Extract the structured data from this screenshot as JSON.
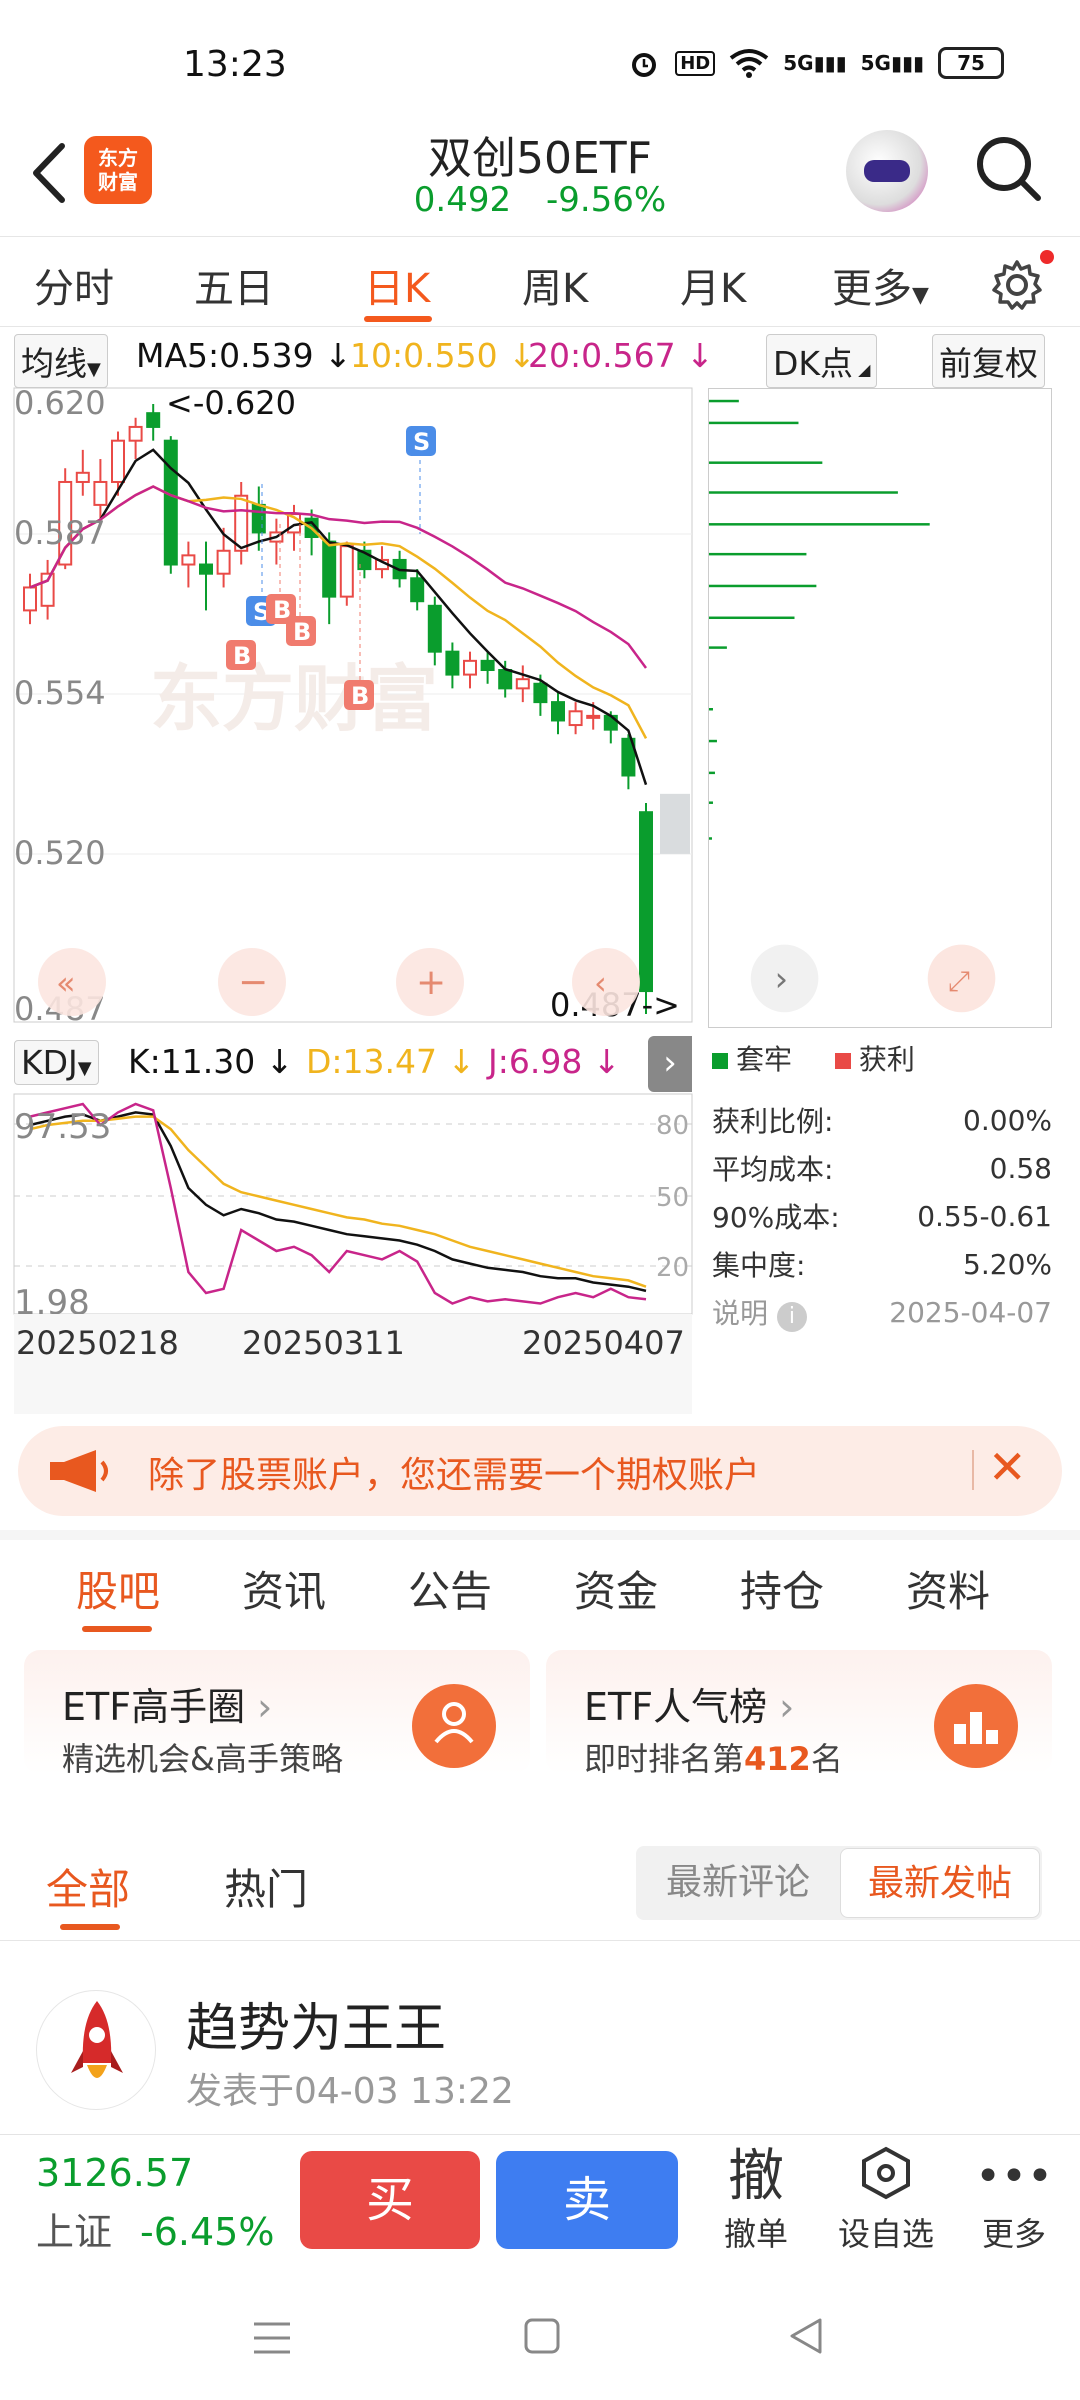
{
  "status_bar": {
    "time": "13:23",
    "network": [
      "HD",
      "5G",
      "5G"
    ],
    "battery": "75"
  },
  "header": {
    "back_icon": "chevron-left-icon",
    "logo_text": "东方财富",
    "title": "双创50ETF",
    "price": "0.492",
    "change": "-9.56%",
    "price_color": "#0a9d2d"
  },
  "period_tabs": {
    "items": [
      "分时",
      "五日",
      "日K",
      "周K",
      "月K",
      "更多"
    ],
    "active": "日K"
  },
  "ma": {
    "label": "均线",
    "ma5": "MA5:0.539",
    "ma10": "10:0.550",
    "ma20": "20:0.567",
    "dk": "DK点",
    "adjust": "前复权"
  },
  "price_axis": {
    "labels": [
      "0.620",
      "0.587",
      "0.554",
      "0.520",
      "0.487"
    ],
    "high_marker": "<-0.620",
    "low_marker": "0.487->"
  },
  "trade_markers": [
    "S",
    "S",
    "B",
    "B",
    "B",
    "B"
  ],
  "watermark": "东方财富",
  "kdj": {
    "label": "KDJ",
    "k": "K:11.30",
    "d": "D:13.47",
    "j": "J:6.98",
    "axis_labels": [
      "97.53",
      "1.98"
    ],
    "levels": [
      "80",
      "50",
      "20"
    ]
  },
  "dates": [
    "20250218",
    "20250311",
    "20250407"
  ],
  "chip_distribution": {
    "legend": [
      "套牢",
      "获利"
    ],
    "stats": [
      {
        "label": "获利比例:",
        "value": "0.00%"
      },
      {
        "label": "平均成本:",
        "value": "0.58"
      },
      {
        "label": "90%成本:",
        "value": "0.55-0.61"
      },
      {
        "label": "集中度:",
        "value": "5.20%"
      }
    ],
    "note": "说明",
    "date": "2025-04-07"
  },
  "colors": {
    "up": "#e94a46",
    "down": "#0a9d2d",
    "ma5": "#111111",
    "ma10": "#f0b41e",
    "ma20": "#c8258a",
    "accent": "#e8581f"
  },
  "banner": {
    "text": "除了股票账户，您还需要一个期权账户"
  },
  "sub_tabs": {
    "items": [
      "股吧",
      "资讯",
      "公告",
      "资金",
      "持仓",
      "资料"
    ],
    "active": "股吧"
  },
  "cards": [
    {
      "title": "ETF高手圈",
      "subtitle": "精选机会&高手策略"
    },
    {
      "title": "ETF人气榜",
      "subtitle_prefix": "即时排名第",
      "rank": "412",
      "subtitle_suffix": "名"
    }
  ],
  "filter": {
    "all": "全部",
    "hot": "热门",
    "latest_comment": "最新评论",
    "latest_post": "最新发帖"
  },
  "post": {
    "author": "趋势为王王",
    "time": "发表于04-03 13:22"
  },
  "bottom_bar": {
    "index_value": "3126.57",
    "index_name": "上证",
    "index_change": "-6.45%",
    "buy": "买",
    "sell": "卖",
    "actions": [
      {
        "icon": "撤",
        "label": "撤单"
      },
      {
        "label": "设自选"
      },
      {
        "label": "更多"
      }
    ]
  }
}
